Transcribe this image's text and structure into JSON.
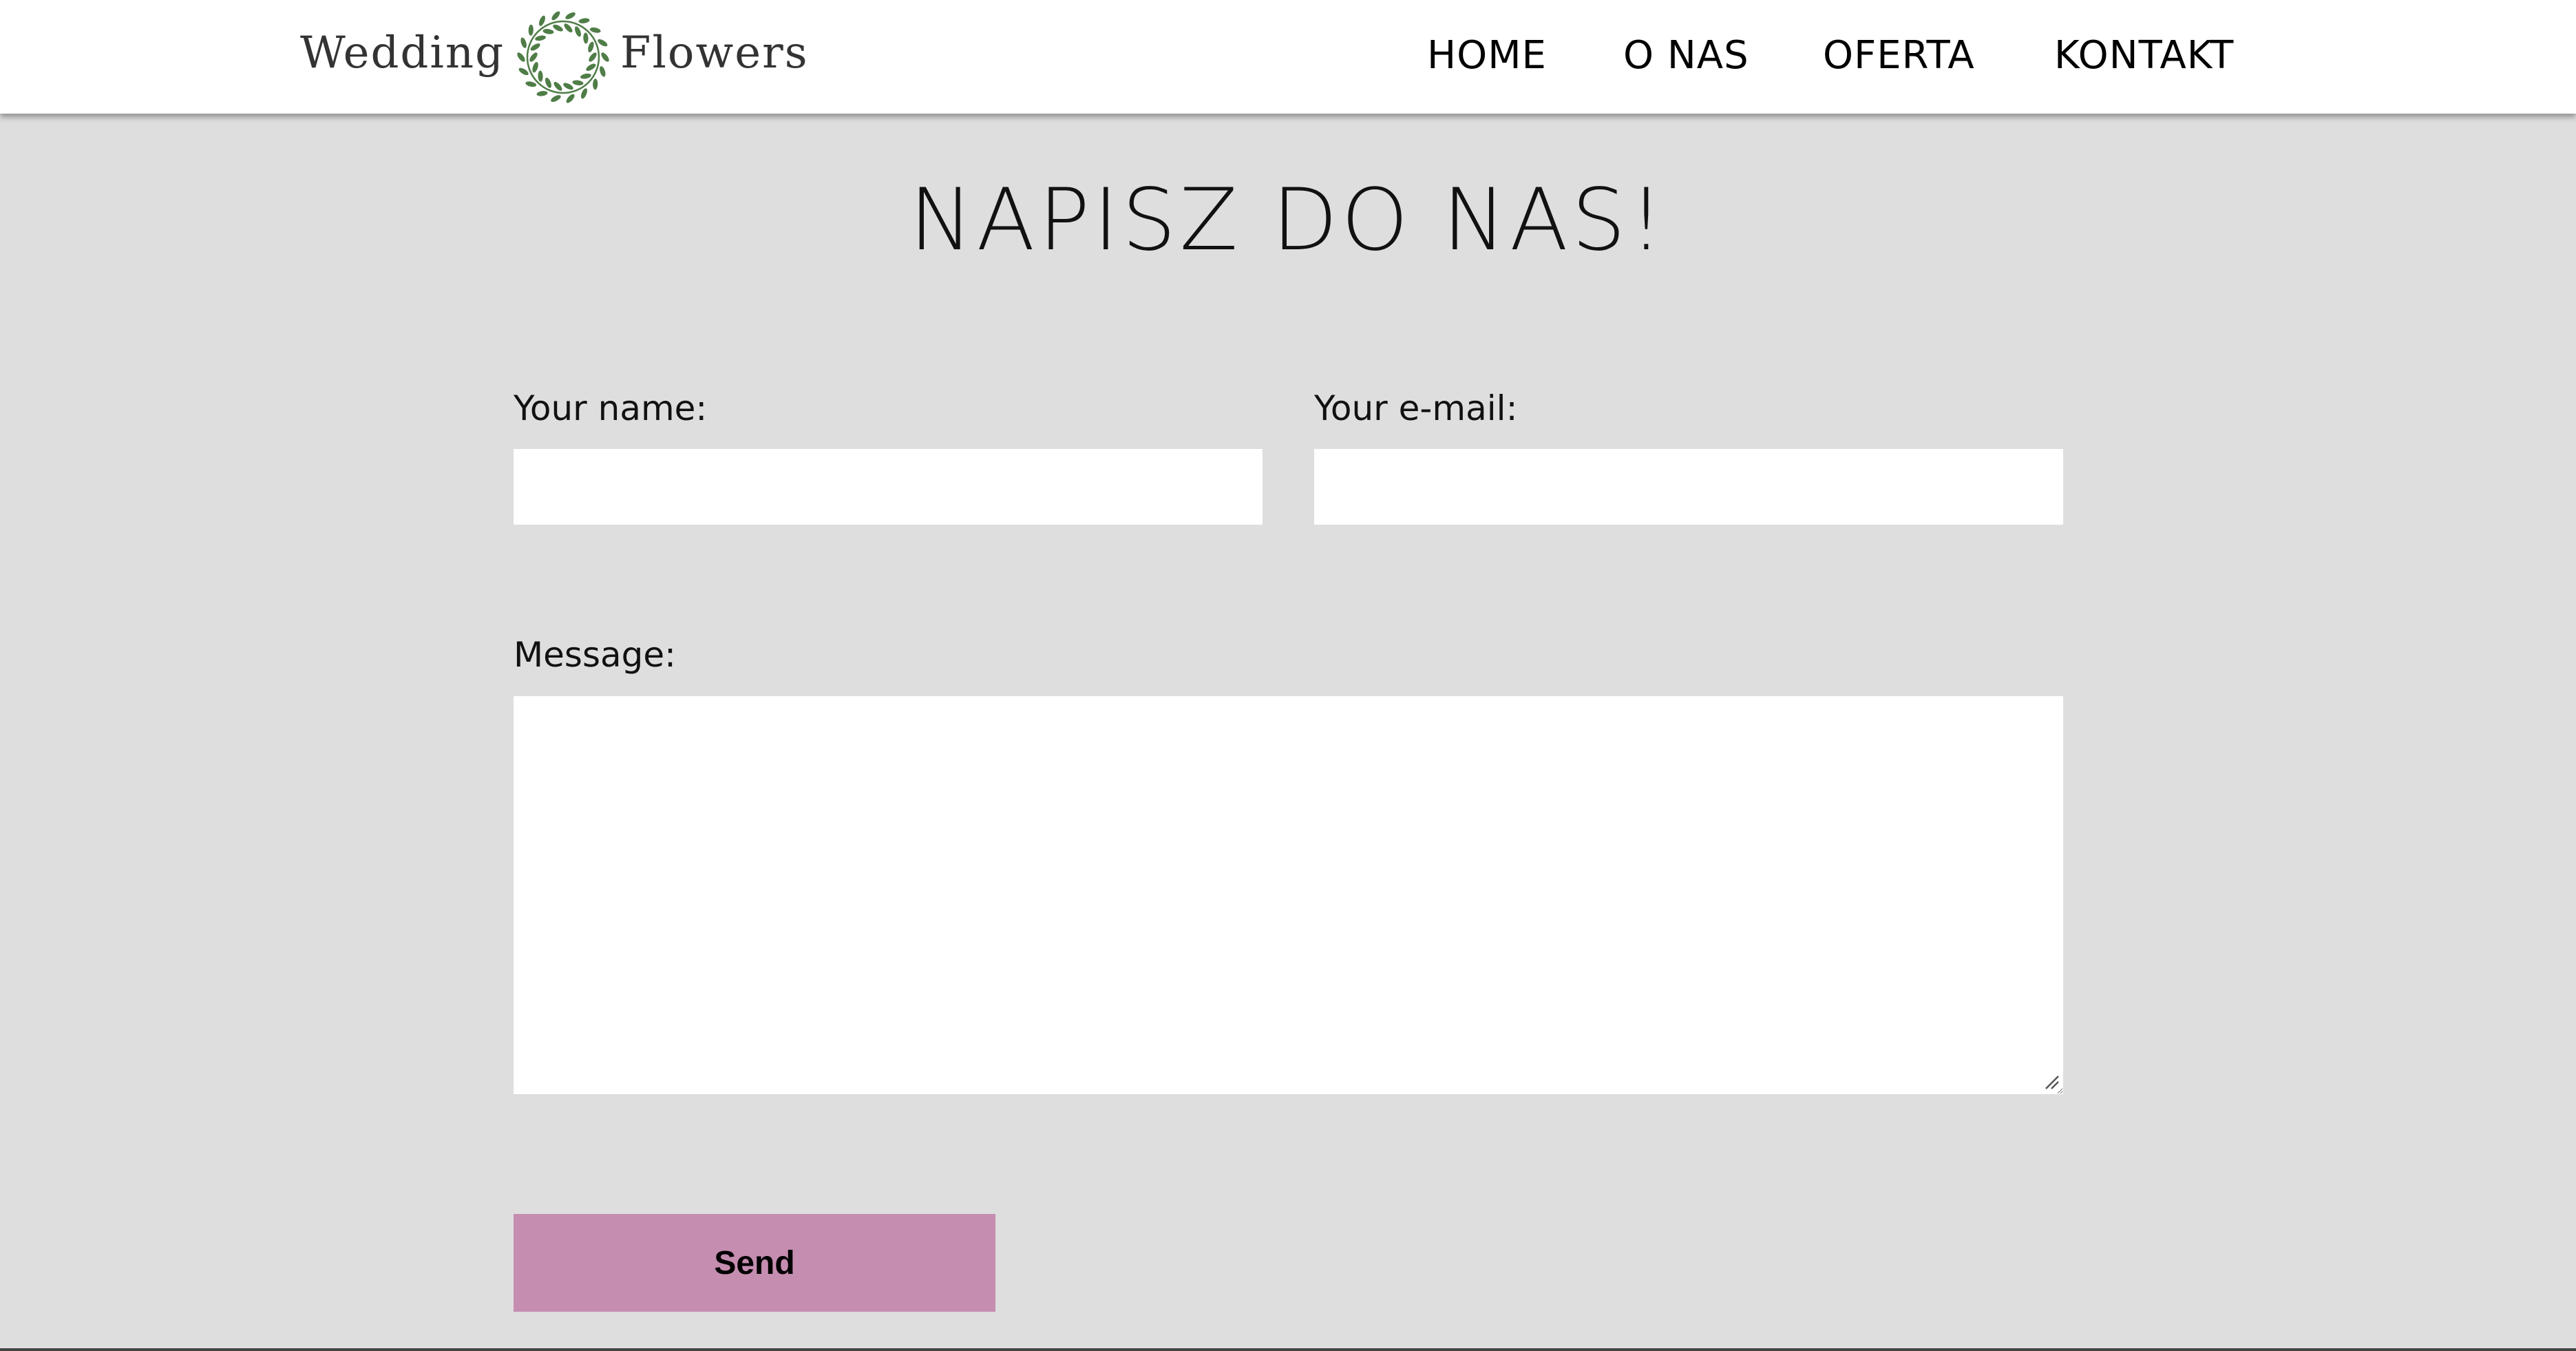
{
  "header": {
    "logo": {
      "word_left": "Wedding",
      "word_right": "Flowers",
      "wreath_icon": "leaf-wreath-icon",
      "wreath_color": "#4f7d47"
    },
    "nav": [
      {
        "label": "HOME"
      },
      {
        "label": "O NAS"
      },
      {
        "label": "OFERTA"
      },
      {
        "label": "KONTAKT"
      }
    ]
  },
  "main": {
    "title": "NAPISZ DO NAS!",
    "form": {
      "name_label": "Your name:",
      "name_value": "",
      "email_label": "Your e-mail:",
      "email_value": "",
      "message_label": "Message:",
      "message_value": "",
      "send_label": "Send"
    }
  },
  "colors": {
    "page_background": "#dedede",
    "header_background": "#ffffff",
    "button_background": "#c58db0",
    "input_background": "#ffffff"
  }
}
